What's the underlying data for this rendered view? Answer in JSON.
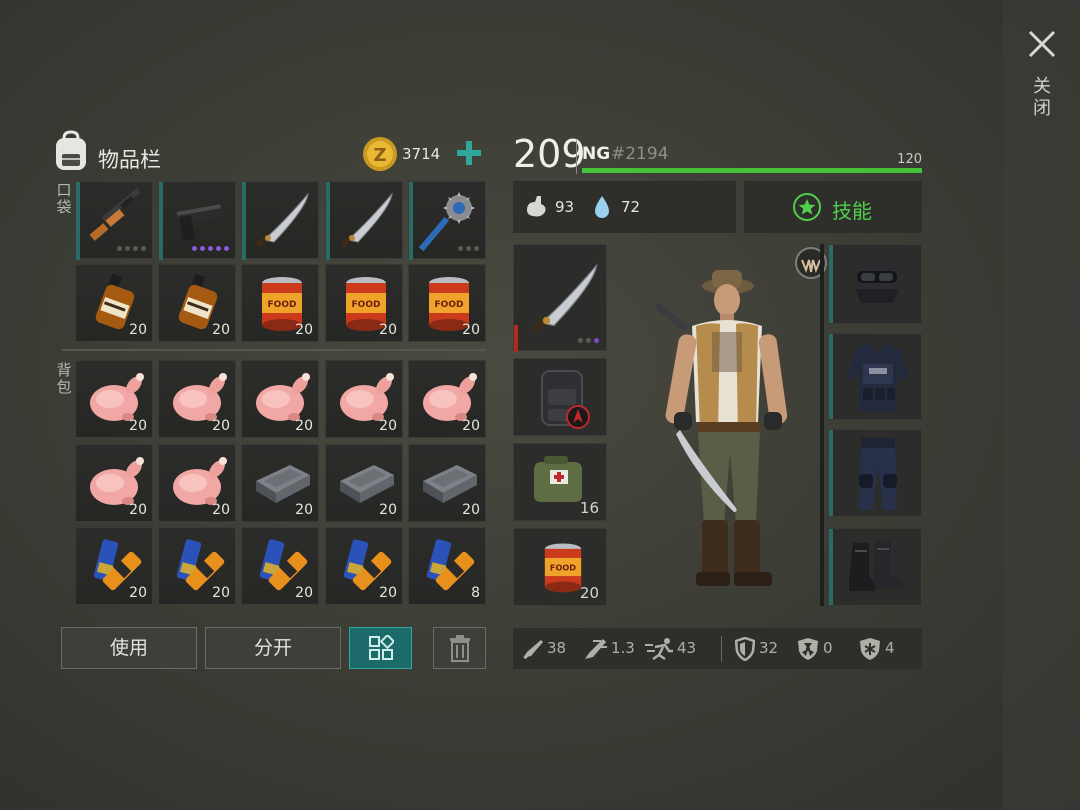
{
  "window": {
    "close_label": "关闭"
  },
  "inventory": {
    "title": "物品栏",
    "coins": "3714",
    "pocket_label": "口袋",
    "backpack_label": "背包",
    "pocket_slots": [
      {
        "item": "rifle",
        "count": "",
        "rarity_dots": 4
      },
      {
        "item": "pistol",
        "count": "",
        "rarity_dots": 5
      },
      {
        "item": "machete",
        "count": ""
      },
      {
        "item": "machete",
        "count": ""
      },
      {
        "item": "spiked-mace",
        "count": ""
      },
      {
        "item": "whiskey",
        "count": "20"
      },
      {
        "item": "whiskey",
        "count": "20"
      },
      {
        "item": "food-can",
        "count": "20"
      },
      {
        "item": "food-can",
        "count": "20"
      },
      {
        "item": "food-can",
        "count": "20"
      }
    ],
    "backpack_slots": [
      {
        "item": "raw-chicken",
        "count": "20"
      },
      {
        "item": "raw-chicken",
        "count": "20"
      },
      {
        "item": "raw-chicken",
        "count": "20"
      },
      {
        "item": "raw-chicken",
        "count": "20"
      },
      {
        "item": "raw-chicken",
        "count": "20"
      },
      {
        "item": "raw-chicken",
        "count": "20"
      },
      {
        "item": "raw-chicken",
        "count": "20"
      },
      {
        "item": "iron-bar",
        "count": "20"
      },
      {
        "item": "iron-bar",
        "count": "20"
      },
      {
        "item": "iron-bar",
        "count": "20"
      },
      {
        "item": "battery",
        "count": "20"
      },
      {
        "item": "battery",
        "count": "20"
      },
      {
        "item": "battery",
        "count": "20"
      },
      {
        "item": "battery",
        "count": "20"
      },
      {
        "item": "battery",
        "count": "8"
      }
    ],
    "buttons": {
      "use": "使用",
      "split": "分开"
    }
  },
  "character": {
    "level": "209",
    "name_prefix": "NG",
    "name_id": "#2194",
    "xp_max": "120",
    "xp_progress": 1.0,
    "hunger": "93",
    "thirst": "72",
    "skills_label": "技能",
    "equip_counts": {
      "medkit": "16",
      "food": "20"
    },
    "bottom_stats": {
      "attack": "38",
      "attack_speed": "1.3",
      "speed": "43",
      "armor": "32",
      "radiation": "0",
      "cold": "4"
    }
  },
  "colors": {
    "accent_green": "#46c23a",
    "teal": "#2b6b66",
    "skill_green": "#4fcf4a"
  }
}
